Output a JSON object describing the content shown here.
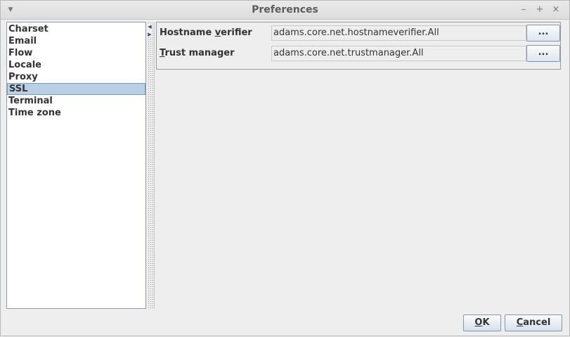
{
  "window": {
    "title": "Preferences",
    "menu_icon": "triangle-down-icon",
    "minimize_glyph": "–",
    "maximize_glyph": "+",
    "close_glyph": "×"
  },
  "nav": {
    "items": [
      {
        "label": "Charset",
        "selected": false
      },
      {
        "label": "Email",
        "selected": false
      },
      {
        "label": "Flow",
        "selected": false
      },
      {
        "label": "Locale",
        "selected": false
      },
      {
        "label": "Proxy",
        "selected": false
      },
      {
        "label": "SSL",
        "selected": true
      },
      {
        "label": "Terminal",
        "selected": false
      },
      {
        "label": "Time zone",
        "selected": false
      }
    ]
  },
  "ssl": {
    "hostname_verifier": {
      "label_pre": "Hostname ",
      "label_mnemonic": "v",
      "label_post": "erifier",
      "value": "adams.core.net.hostnameverifier.All",
      "button": "..."
    },
    "trust_manager": {
      "label_pre": "",
      "label_mnemonic": "T",
      "label_post": "rust manager",
      "value": "adams.core.net.trustmanager.All",
      "button": "..."
    }
  },
  "footer": {
    "ok_mnemonic": "O",
    "ok_rest": "K",
    "cancel_mnemonic": "C",
    "cancel_rest": "ancel"
  }
}
